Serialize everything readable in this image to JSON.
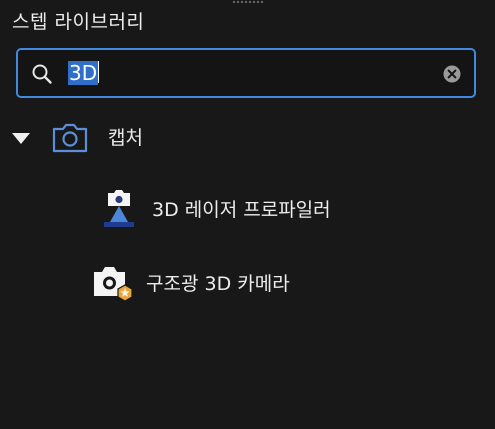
{
  "panel": {
    "title": "스텝 라이브러리"
  },
  "search": {
    "value": "3D",
    "icon": "search-icon",
    "clear_icon": "clear-search-icon"
  },
  "tree": {
    "category": {
      "label": "캡처",
      "expanded": true,
      "icon": "camera-icon"
    },
    "items": [
      {
        "label": "3D 레이저 프로파일러",
        "icon": "laser-profiler-icon"
      },
      {
        "label": "구조광 3D 카메라",
        "icon": "structured-light-camera-icon"
      }
    ]
  },
  "colors": {
    "background": "#181818",
    "accent": "#3f8ae0",
    "selection": "#2f6ec9",
    "text": "#ececec",
    "badge": "#e9a53b"
  }
}
